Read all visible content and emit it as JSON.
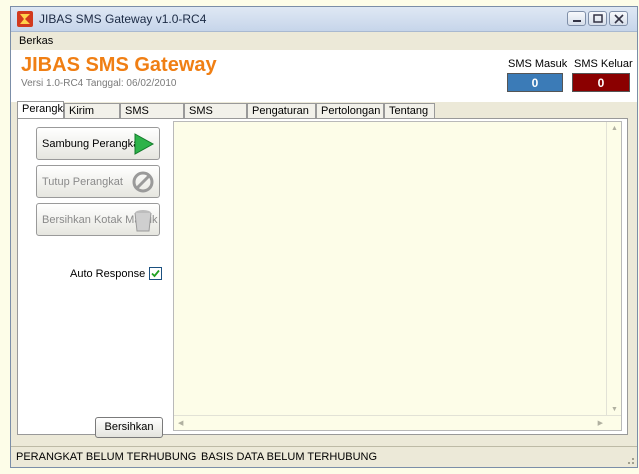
{
  "window": {
    "title": "JIBAS SMS Gateway v1.0-RC4"
  },
  "menu": {
    "items": [
      "Berkas"
    ]
  },
  "header": {
    "app_name": "JIBAS SMS Gateway",
    "version": "Versi 1.0-RC4 Tanggal: 06/02/2010",
    "sms_in": {
      "label": "SMS Masuk",
      "value": "0",
      "color": "#3b7bb7"
    },
    "sms_out": {
      "label": "SMS Keluar",
      "value": "0",
      "color": "#8b0000"
    }
  },
  "tabs": [
    "Perangkat",
    "Kirim SMS",
    "SMS Keluar",
    "SMS Masuk",
    "Pengaturan",
    "Pertolongan",
    "Tentang"
  ],
  "active_tab": "Perangkat",
  "device_panel": {
    "connect_label": "Sambung Perangkat",
    "close_label": "Tutup Perangkat",
    "clear_inbox_label": "Bersihkan Kotak Masuk",
    "auto_response_label": "Auto Response",
    "auto_response_checked": true,
    "clear_label": "Bersihkan"
  },
  "status": {
    "device": "PERANGKAT BELUM TERHUBUNG",
    "database": "BASIS DATA BELUM TERHUBUNG"
  }
}
